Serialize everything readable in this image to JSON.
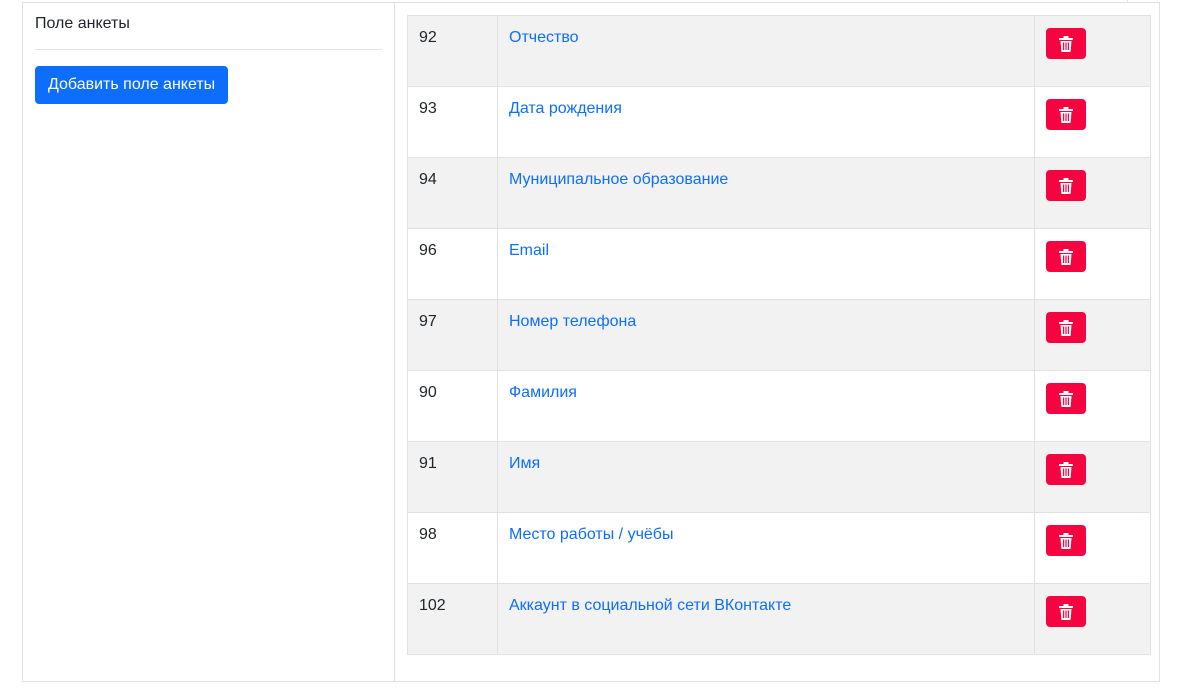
{
  "sidebar": {
    "title": "Поле анкеты",
    "add_button_label": "Добавить поле анкеты"
  },
  "table": {
    "rows": [
      {
        "id": "92",
        "name": "Отчество"
      },
      {
        "id": "93",
        "name": "Дата рождения"
      },
      {
        "id": "94",
        "name": "Муниципальное образование"
      },
      {
        "id": "96",
        "name": "Email"
      },
      {
        "id": "97",
        "name": "Номер телефона"
      },
      {
        "id": "90",
        "name": "Фамилия"
      },
      {
        "id": "91",
        "name": "Имя"
      },
      {
        "id": "98",
        "name": "Место работы / учёбы"
      },
      {
        "id": "102",
        "name": "Аккаунт в социальной сети ВКонтакте"
      }
    ],
    "delete_icon": "trash-icon"
  },
  "colors": {
    "primary": "#0d6efd",
    "danger": "#f5043f",
    "stripe": "#f2f2f2",
    "border": "#dee2e6"
  }
}
